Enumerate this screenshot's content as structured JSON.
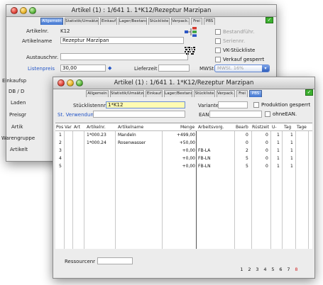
{
  "back": {
    "title": "Artikel (1) : 1/641 1. 1*K12/Rezeptur Marzipan",
    "tabs": [
      "Allgemein",
      "Statistik/Umsätze",
      "Einkauf",
      "Lager/Bestand",
      "Stückliste",
      "Verpack.",
      "Frei",
      "PBS"
    ],
    "artikelnr_label": "Artikelnr.",
    "artikelnr_value": "K12",
    "artikelname_label": "Artikelname",
    "artikelname_value": "Rezeptur Marzipan",
    "austauschnr_label": "Austauschnr.",
    "listenpreis_label": "Listenpreis",
    "listenpreis_value": "30,00",
    "lieferzeit_label": "Lieferzeit",
    "mwst_label": "MWSt.",
    "mwst_value": "MWSt. 16%",
    "einkaufspreis_label": "Einkaufsp",
    "db_label": "DB / D",
    "ladenpreis_label": "Laden",
    "preisgruppe_label": "Preisgr",
    "artikel_label": "Artik",
    "warengruppe_label": "Warengruppe",
    "artikeltext_label": "Artikelt",
    "check_bestandfuehr": "Bestandführ.",
    "check_seriennr": "Seriennr.",
    "check_vk_stueckliste": "VK-Stückliste",
    "check_verkauf_gesperrt": "Verkauf gesperrt"
  },
  "front": {
    "title": "Artikel (1) : 1/641 1. 1*K12/Rezeptur Marzipan",
    "tabs": [
      "Allgemein",
      "Statistik/Umsätze",
      "Einkauf",
      "Lager/Bestand",
      "Stückliste",
      "Verpack.",
      "Frei",
      "PBS"
    ],
    "stuecklistennr_label": "Stücklistennr.",
    "stuecklistennr_value": "1*K12",
    "variante_label": "Variante",
    "produktion_gesperrt": "Produktion gesperrt",
    "st_verwendung_label": "St. Verwendung",
    "ean_label": "EAN",
    "ohne_ean": "ohneEAN.",
    "columns": [
      "Pos",
      "Var",
      "Art",
      "Artikelnr.",
      "Artikelname",
      "Menge",
      "Arbeitsvorg.",
      "Bearb",
      "Rüstzeit",
      "U-",
      "Tag",
      "Tage"
    ],
    "rows": [
      {
        "pos": "1",
        "artnr": "1*000.23",
        "name": "Mandeln",
        "menge": "+499,00",
        "arbeit": "",
        "bearb": "0",
        "ruest": "0",
        "u": "1",
        "tag": "1"
      },
      {
        "pos": "2",
        "artnr": "1*000.24",
        "name": "Rosenwasser",
        "menge": "+50,00",
        "arbeit": "",
        "bearb": "0",
        "ruest": "0",
        "u": "1",
        "tag": "1"
      },
      {
        "pos": "3",
        "artnr": "",
        "name": "",
        "menge": "+0,00",
        "arbeit": "FB-LA",
        "bearb": "2",
        "ruest": "0",
        "u": "1",
        "tag": "1"
      },
      {
        "pos": "4",
        "artnr": "",
        "name": "",
        "menge": "+0,00",
        "arbeit": "FB-LN",
        "bearb": "5",
        "ruest": "0",
        "u": "1",
        "tag": "1"
      },
      {
        "pos": "5",
        "artnr": "",
        "name": "",
        "menge": "+0,00",
        "arbeit": "FB-LN",
        "bearb": "5",
        "ruest": "0",
        "u": "1",
        "tag": "1"
      }
    ],
    "ressourcenr_label": "Ressourcenr",
    "pages": [
      "1",
      "2",
      "3",
      "4",
      "5",
      "6",
      "7",
      "8"
    ],
    "current_page": "8"
  },
  "colors": {
    "accent": "#2456c8",
    "tab_selected": "#3f73cf",
    "highlight_field": "#fffbb3",
    "flag": "#3cb02f",
    "current_page": "#d12a2a"
  }
}
